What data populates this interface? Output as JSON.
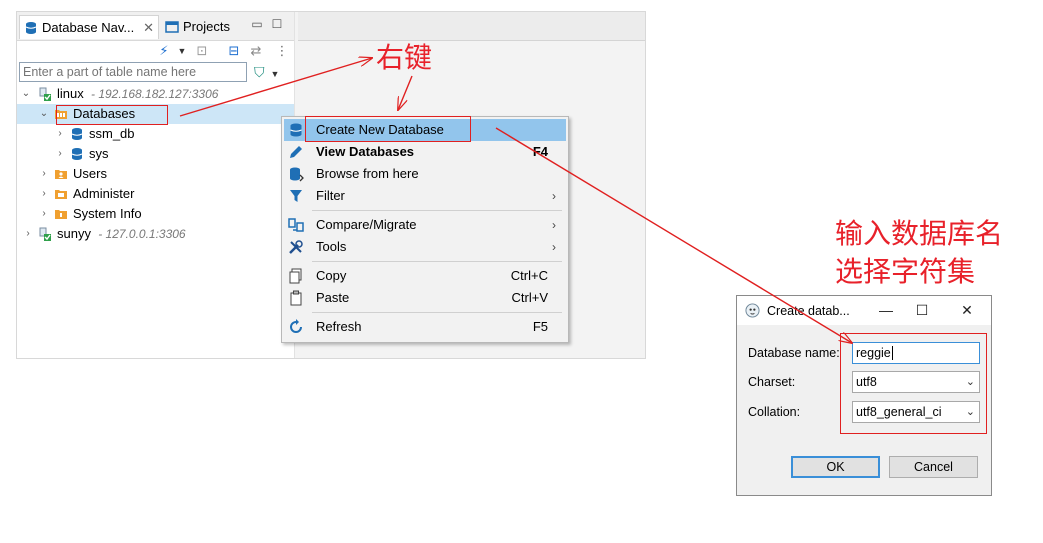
{
  "navigator": {
    "tabs": [
      {
        "label": "Database Nav..."
      },
      {
        "label": "Projects"
      }
    ],
    "close_glyph": "✕",
    "filter_placeholder": "Enter a part of table name here",
    "tree": {
      "linux": {
        "label": "linux",
        "address": "- 192.168.182.127:3306"
      },
      "databases": {
        "label": "Databases"
      },
      "ssm_db": {
        "label": "ssm_db"
      },
      "sys": {
        "label": "sys"
      },
      "users": {
        "label": "Users"
      },
      "administer": {
        "label": "Administer"
      },
      "system_info": {
        "label": "System Info"
      },
      "sunyy": {
        "label": "sunyy",
        "address": "- 127.0.0.1:3306"
      }
    }
  },
  "context_menu": {
    "items": [
      {
        "label": "Create New Database",
        "shortcut": "",
        "icon": "database-add-icon"
      },
      {
        "label": "View Databases",
        "shortcut": "F4",
        "icon": "pencil-icon"
      },
      {
        "label": "Browse from here",
        "shortcut": "",
        "icon": "database-browse-icon"
      },
      {
        "label": "Filter",
        "shortcut": "",
        "icon": "funnel-icon"
      },
      {
        "label": "Compare/Migrate",
        "shortcut": "",
        "icon": "compare-icon"
      },
      {
        "label": "Tools",
        "shortcut": "",
        "icon": "tools-icon"
      },
      {
        "label": "Copy",
        "shortcut": "Ctrl+C",
        "icon": "copy-icon"
      },
      {
        "label": "Paste",
        "shortcut": "Ctrl+V",
        "icon": "paste-icon"
      },
      {
        "label": "Refresh",
        "shortcut": "F5",
        "icon": "refresh-icon"
      }
    ],
    "submenu_glyph": "›"
  },
  "annotations": {
    "right_click": "右键",
    "instruction_line1": "输入数据库名",
    "instruction_line2": "选择字符集"
  },
  "dialog": {
    "title": "Create datab...",
    "labels": {
      "name": "Database name:",
      "charset": "Charset:",
      "collation": "Collation:"
    },
    "values": {
      "name": "reggie",
      "charset": "utf8",
      "collation": "utf8_general_ci"
    },
    "buttons": {
      "ok": "OK",
      "cancel": "Cancel"
    },
    "controls": {
      "minimize": "—",
      "maximize": "☐",
      "close": "✕"
    }
  },
  "colors": {
    "annotation_red": "#e8212a",
    "selection_blue": "#cde6f7",
    "menu_highlight": "#92c5ec",
    "db_icon_blue": "#1f6fb5",
    "folder_orange": "#f0a030"
  }
}
